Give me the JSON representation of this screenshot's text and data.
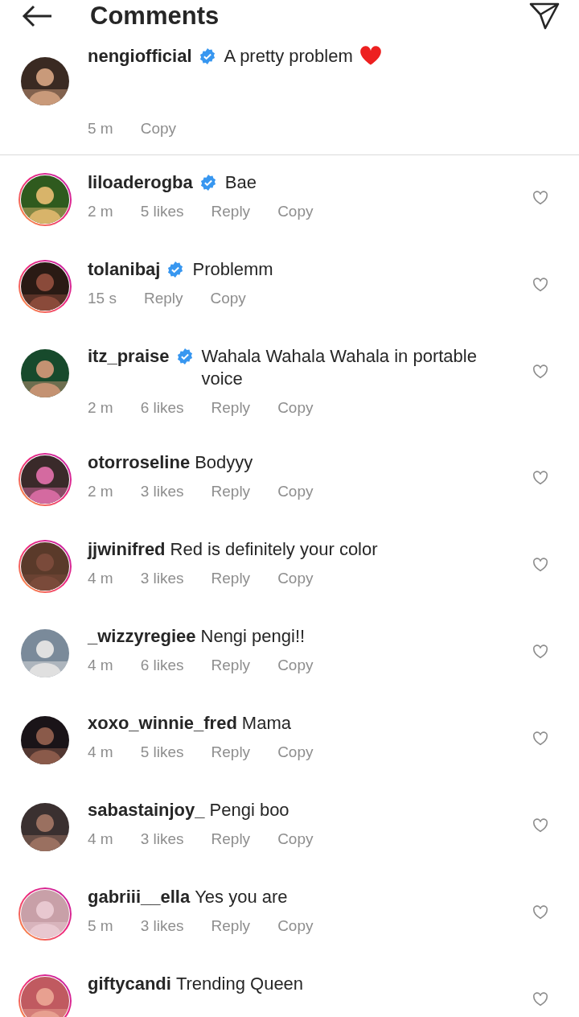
{
  "header": {
    "title": "Comments"
  },
  "caption": {
    "username": "nengiofficial",
    "verified": true,
    "text": "A pretty problem",
    "meta": [
      "5 m",
      "Copy"
    ],
    "story_ring": false
  },
  "comments": [
    {
      "username": "liloaderogba",
      "verified": true,
      "text": "Bae",
      "story_ring": true,
      "meta": [
        "2 m",
        "5 likes",
        "Reply",
        "Copy"
      ]
    },
    {
      "username": "tolanibaj",
      "verified": true,
      "text": "Problemm",
      "story_ring": true,
      "meta": [
        "15 s",
        "Reply",
        "Copy"
      ]
    },
    {
      "username": "itz_praise",
      "verified": true,
      "text": "Wahala Wahala Wahala in portable voice",
      "story_ring": false,
      "meta": [
        "2 m",
        "6 likes",
        "Reply",
        "Copy"
      ]
    },
    {
      "username": "otorroseline",
      "verified": false,
      "text": "Bodyyy",
      "story_ring": true,
      "meta": [
        "2 m",
        "3 likes",
        "Reply",
        "Copy"
      ]
    },
    {
      "username": "jjwinifred",
      "verified": false,
      "text": "Red is definitely your color",
      "story_ring": true,
      "meta": [
        "4 m",
        "3 likes",
        "Reply",
        "Copy"
      ]
    },
    {
      "username": "_wizzyregiee",
      "verified": false,
      "text": "Nengi pengi!!",
      "story_ring": false,
      "meta": [
        "4 m",
        "6 likes",
        "Reply",
        "Copy"
      ]
    },
    {
      "username": "xoxo_winnie_fred",
      "verified": false,
      "text": "Mama",
      "story_ring": false,
      "meta": [
        "4 m",
        "5 likes",
        "Reply",
        "Copy"
      ]
    },
    {
      "username": "sabastainjoy_",
      "verified": false,
      "text": "Pengi boo",
      "story_ring": false,
      "meta": [
        "4 m",
        "3 likes",
        "Reply",
        "Copy"
      ]
    },
    {
      "username": "gabriii__ella",
      "verified": false,
      "text": "Yes you are",
      "story_ring": true,
      "meta": [
        "5 m",
        "3 likes",
        "Reply",
        "Copy"
      ]
    },
    {
      "username": "giftycandi",
      "verified": false,
      "text": "Trending Queen",
      "story_ring": true
    }
  ]
}
